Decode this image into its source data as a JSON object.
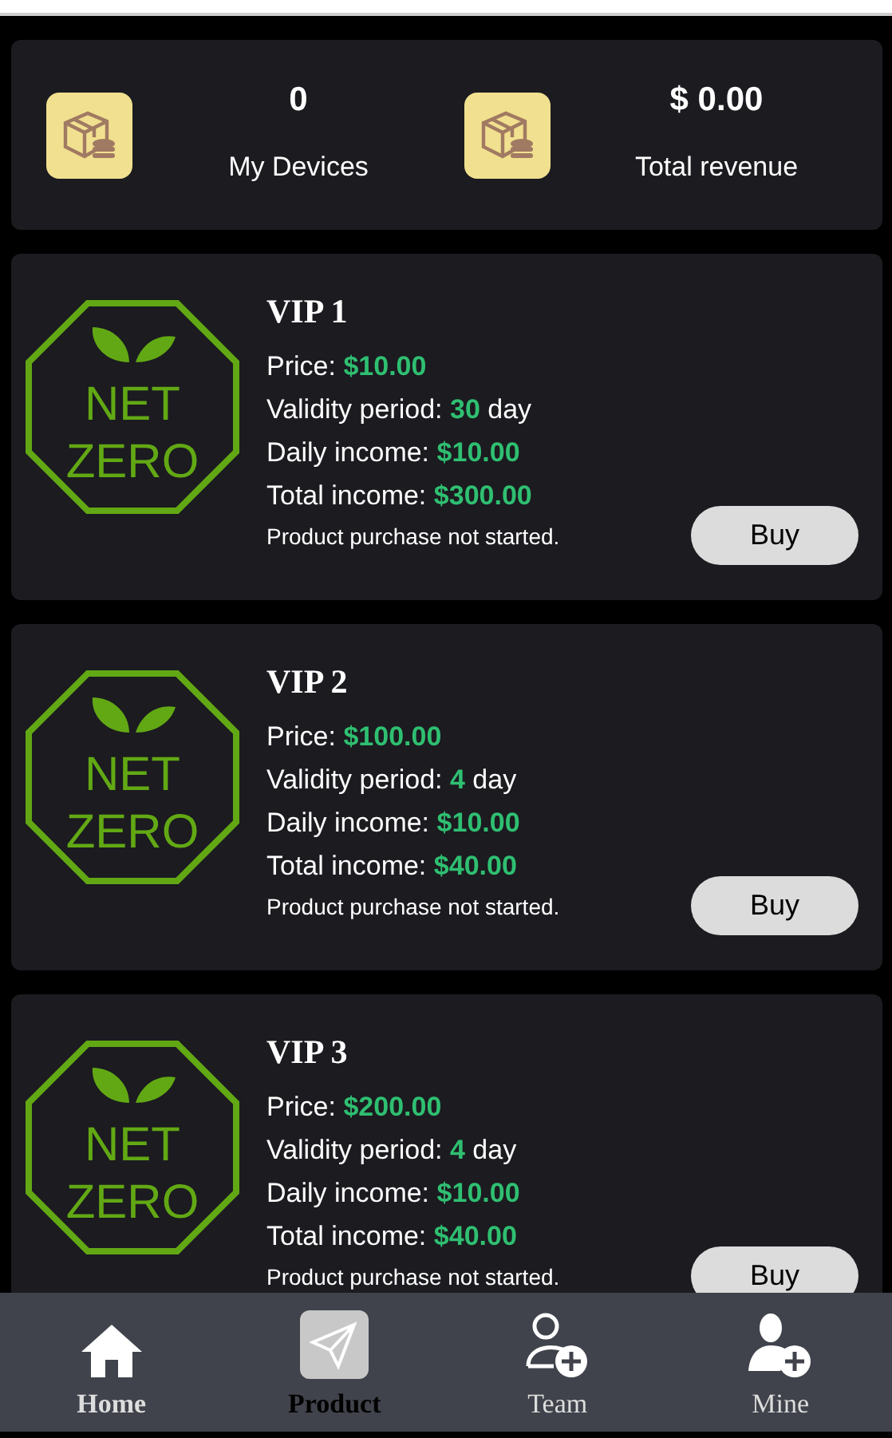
{
  "stats": [
    {
      "value": "0",
      "label": "My Devices"
    },
    {
      "value": "$ 0.00",
      "label": "Total revenue"
    }
  ],
  "products": [
    {
      "logo": [
        "NET",
        "ZERO"
      ],
      "title": "VIP 1",
      "lines": [
        {
          "label": "Price:",
          "value": "$10.00"
        },
        {
          "label": "Validity period:",
          "value": "30",
          "unit": "day"
        },
        {
          "label": "Daily income:",
          "value": "$10.00"
        },
        {
          "label": "Total income:",
          "value": "$300.00"
        }
      ],
      "status": "Product purchase not started.",
      "button": "Buy"
    },
    {
      "logo": [
        "NET",
        "ZERO"
      ],
      "title": "VIP 2",
      "lines": [
        {
          "label": "Price:",
          "value": "$100.00"
        },
        {
          "label": "Validity period:",
          "value": "4",
          "unit": "day"
        },
        {
          "label": "Daily income:",
          "value": "$10.00"
        },
        {
          "label": "Total income:",
          "value": "$40.00"
        }
      ],
      "status": "Product purchase not started.",
      "button": "Buy"
    },
    {
      "logo": [
        "NET",
        "ZERO"
      ],
      "title": "VIP 3",
      "lines": [
        {
          "label": "Price:",
          "value": "$200.00"
        },
        {
          "label": "Validity period:",
          "value": "4",
          "unit": "day"
        },
        {
          "label": "Daily income:",
          "value": "$10.00"
        },
        {
          "label": "Total income:",
          "value": "$40.00"
        }
      ],
      "status": "Product purchase not started.",
      "button": "Buy"
    }
  ],
  "nav": [
    {
      "kind": "home",
      "label": "Home",
      "selected": false
    },
    {
      "kind": "product",
      "label": "Product",
      "selected": true
    },
    {
      "kind": "team",
      "label": "Team",
      "selected": false
    },
    {
      "kind": "mine",
      "label": "Mine",
      "selected": false
    }
  ]
}
